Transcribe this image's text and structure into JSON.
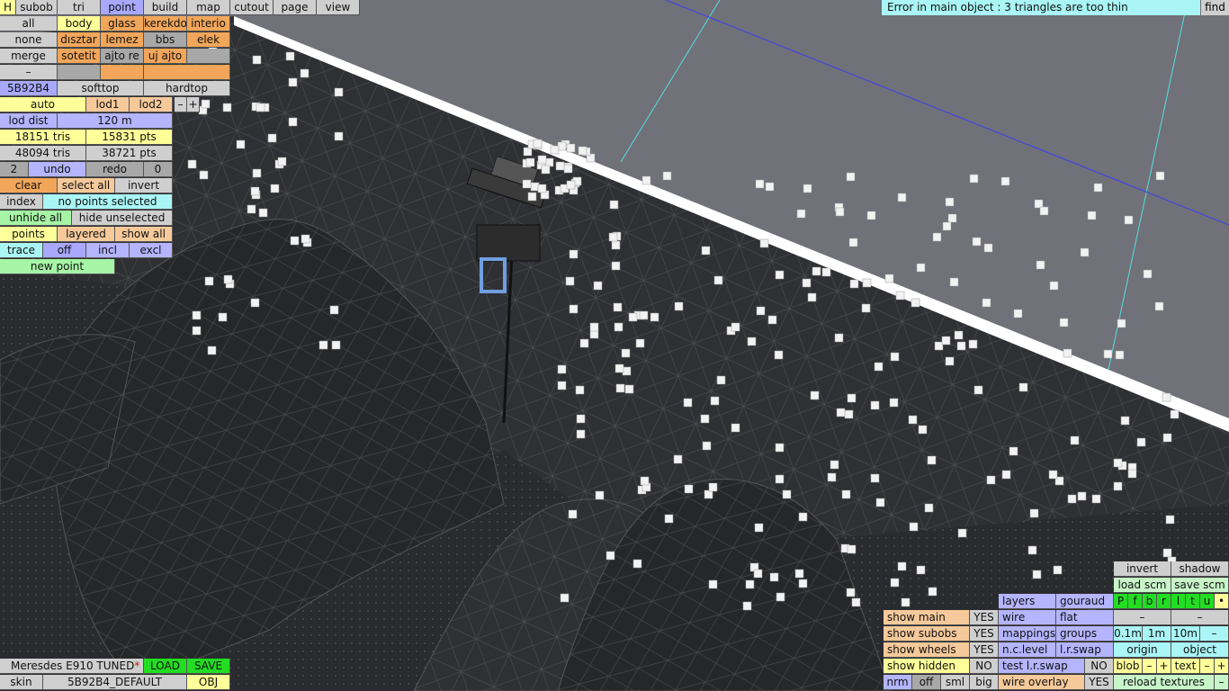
{
  "top_tabs": [
    "H",
    "subob",
    "tri",
    "point",
    "build",
    "map",
    "cutout",
    "page",
    "view"
  ],
  "error_message": "Error in main object : 3 triangles are too thin",
  "find_label": "find",
  "groups_row1": [
    "all",
    "body",
    "glass",
    "kerekdo",
    "interio"
  ],
  "groups_row2": [
    "none",
    "dısztar",
    "lemez",
    "bbs",
    "elek"
  ],
  "groups_row3": [
    "merge",
    "sotetit",
    "ajto re",
    "uj ajto",
    ""
  ],
  "groups_row4": [
    "–",
    "",
    "",
    ""
  ],
  "color_row": {
    "hex": "5B92B4",
    "softtop": "softtop",
    "hardtop": "hardtop"
  },
  "lod_row": {
    "auto": "auto",
    "lod1": "lod1",
    "lod2": "lod2",
    "minus": "–",
    "plus": "+"
  },
  "lod_dist": {
    "label": "lod dist",
    "value": "120 m"
  },
  "stats1": {
    "tris": "18151 tris",
    "pts": "15831 pts"
  },
  "stats2": {
    "tris": "48094 tris",
    "pts": "38721 pts"
  },
  "undo_row": {
    "left": "2",
    "undo": "undo",
    "redo": "redo",
    "right": "0"
  },
  "select_row": {
    "clear": "clear",
    "select_all": "select all",
    "invert": "invert"
  },
  "index_row": {
    "index": "index",
    "status": "no points selected"
  },
  "hide_row": {
    "unhide_all": "unhide all",
    "hide_unselected": "hide unselected"
  },
  "points_row": {
    "points": "points",
    "layered": "layered",
    "show_all": "show all"
  },
  "trace_row": {
    "trace": "trace",
    "off": "off",
    "incl": "incl",
    "excl": "excl"
  },
  "new_point": "new point",
  "model": {
    "name": "Meresdes E910 TUNED",
    "star": "*",
    "load": "LOAD",
    "save": "SAVE"
  },
  "skin": {
    "label": "skin",
    "value": "5B92B4_DEFAULT",
    "obj": "OBJ"
  },
  "right_panel": {
    "invert": "invert",
    "shadow": "shadow",
    "load_scm": "load scm",
    "save_scm": "save scm",
    "flags": [
      "P",
      "f",
      "b",
      "r",
      "l",
      "t",
      "u",
      "•"
    ],
    "layers": "layers",
    "gouraud": "gouraud",
    "wire": "wire",
    "flat": "flat",
    "dash1": "–",
    "dash2": "–",
    "show_main": "show main",
    "show_main_val": "YES",
    "show_subobs": "show subobs",
    "show_subobs_val": "YES",
    "show_wheels": "show wheels",
    "show_wheels_val": "YES",
    "show_hidden": "show hidden",
    "show_hidden_val": "NO",
    "mappings": "mappings",
    "groups": "groups",
    "m01": "0.1m",
    "m1": "1m",
    "m10": "10m",
    "mminus": "–",
    "nclevel": "n.c.level",
    "lrswap": "l.r.swap",
    "origin": "origin",
    "object": "object",
    "test_lr": "test l.r.swap",
    "test_lr_val": "NO",
    "blob": "blob",
    "blob_minus": "–",
    "blob_plus": "+",
    "text": "text",
    "text_minus": "–",
    "text_plus": "+",
    "nrm": "nrm",
    "off": "off",
    "sml": "sml",
    "big": "big",
    "wire_overlay": "wire overlay",
    "wire_overlay_val": "YES",
    "reload": "reload textures",
    "reload_minus": "–"
  }
}
